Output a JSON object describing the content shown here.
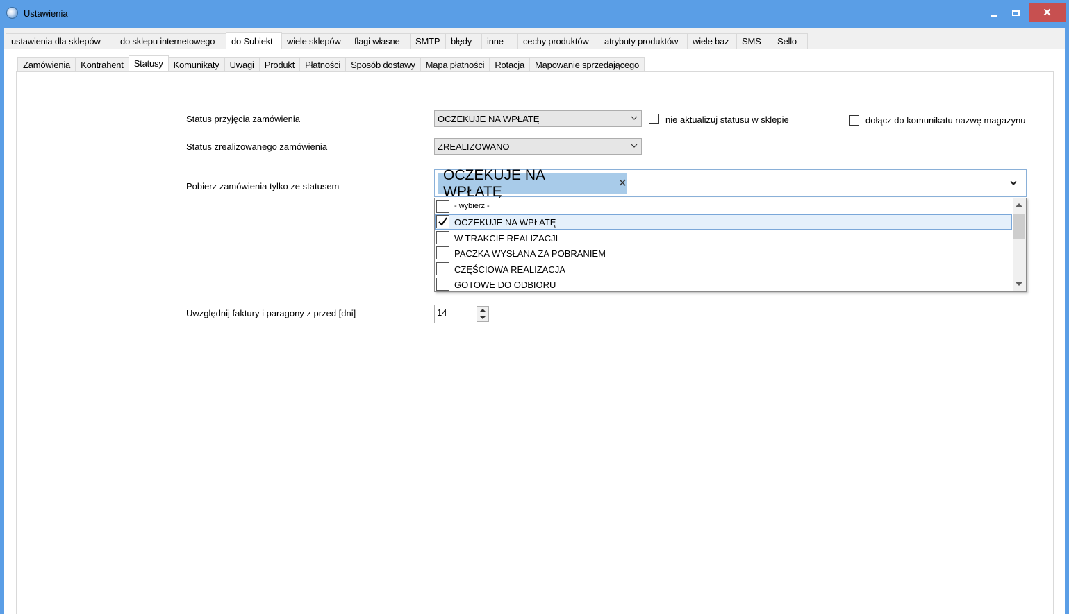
{
  "window": {
    "title": "Ustawienia"
  },
  "main_tabs": [
    {
      "label": "ustawienia dla sklepów"
    },
    {
      "label": "do sklepu internetowego"
    },
    {
      "label": "do Subiekt"
    },
    {
      "label": "wiele sklepów"
    },
    {
      "label": "flagi własne"
    },
    {
      "label": "SMTP"
    },
    {
      "label": "błędy"
    },
    {
      "label": "inne"
    },
    {
      "label": "cechy produktów"
    },
    {
      "label": "atrybuty produktów"
    },
    {
      "label": "wiele baz"
    },
    {
      "label": "SMS"
    },
    {
      "label": "Sello"
    }
  ],
  "main_tabs_active": "do Subiekt",
  "sub_tabs": [
    {
      "label": "Zamówienia"
    },
    {
      "label": "Kontrahent"
    },
    {
      "label": "Statusy"
    },
    {
      "label": "Komunikaty"
    },
    {
      "label": "Uwagi"
    },
    {
      "label": "Produkt"
    },
    {
      "label": "Płatności"
    },
    {
      "label": "Sposób dostawy"
    },
    {
      "label": "Mapa płatności"
    },
    {
      "label": "Rotacja"
    },
    {
      "label": "Mapowanie sprzedającego"
    }
  ],
  "sub_tabs_active": "Statusy",
  "form": {
    "status_acceptance_label": "Status przyjęcia zamówienia",
    "status_acceptance_value": "OCZEKUJE NA WPŁATĘ",
    "no_update_label": "nie aktualizuj statusu w sklepie",
    "no_update_checked": false,
    "attach_warehouse_label": "dołącz do komunikatu nazwę magazynu",
    "attach_warehouse_checked": false,
    "status_completed_label": "Status zrealizowanego zamówienia",
    "status_completed_value": "ZREALIZOWANO",
    "fetch_status_label": "Pobierz zamówienia tylko ze statusem",
    "fetch_status_selected_tag": "OCZEKUJE NA WPŁATĘ",
    "fetch_status_tag_remove": "×",
    "fetch_status_options": [
      {
        "label": "- wybierz -",
        "checked": false
      },
      {
        "label": "OCZEKUJE NA WPŁATĘ",
        "checked": true
      },
      {
        "label": "W TRAKCIE REALIZACJI",
        "checked": false
      },
      {
        "label": "PACZKA WYSŁANA ZA POBRANIEM",
        "checked": false
      },
      {
        "label": "CZĘŚCIOWA REALIZACJA",
        "checked": false
      },
      {
        "label": "GOTOWE DO ODBIORU",
        "checked": false
      }
    ],
    "invoices_days_label": "Uwzględnij faktury i paragony z przed [dni]",
    "invoices_days_value": "14"
  },
  "icons": {
    "app": "settings-app-icon",
    "minimize": "minimize-icon",
    "maximize": "maximize-icon",
    "close": "close-icon",
    "combo_arrow": "chevron-down-icon",
    "checkmark": "checkmark-icon"
  },
  "colors": {
    "titlebar": "#5a9ee6",
    "close_button": "#c75050",
    "tag_background": "#a8cbe9",
    "selected_row": "#e5f0fb"
  }
}
